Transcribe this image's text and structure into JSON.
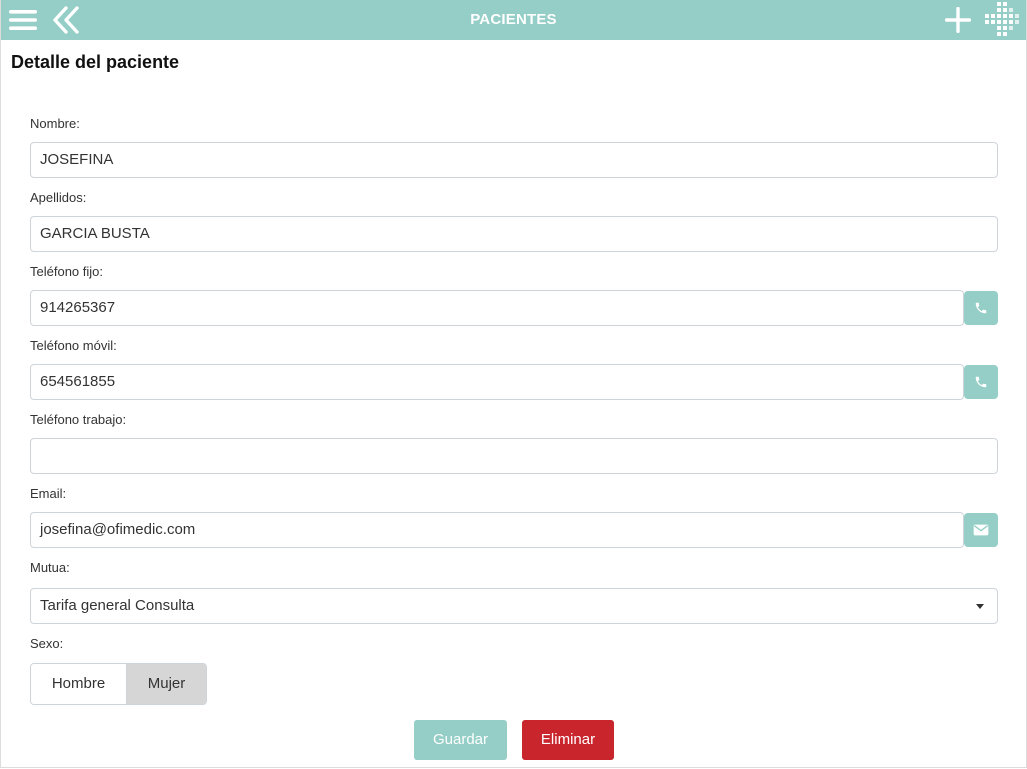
{
  "header": {
    "title": "PACIENTES",
    "menu_icon": "hamburger-menu-icon",
    "back_icon": "double-chevron-left-icon",
    "add_icon": "plus-icon",
    "logo_icon": "pixel-cross-logo-icon"
  },
  "page": {
    "title": "Detalle del paciente"
  },
  "form": {
    "nombre": {
      "label": "Nombre:",
      "value": "JOSEFINA"
    },
    "apellidos": {
      "label": "Apellidos:",
      "value": "GARCIA BUSTA"
    },
    "telefono_fijo": {
      "label": "Teléfono fijo:",
      "value": "914265367",
      "action_icon": "phone-icon"
    },
    "telefono_movil": {
      "label": "Teléfono móvil:",
      "value": "654561855",
      "action_icon": "phone-icon"
    },
    "telefono_trabajo": {
      "label": "Teléfono trabajo:",
      "value": ""
    },
    "email": {
      "label": "Email:",
      "value": "josefina@ofimedic.com",
      "action_icon": "envelope-icon"
    },
    "mutua": {
      "label": "Mutua:",
      "selected": "Tarifa general Consulta"
    },
    "sexo": {
      "label": "Sexo:",
      "options": [
        "Hombre",
        "Mujer"
      ],
      "selected": "Mujer"
    }
  },
  "actions": {
    "save_label": "Guardar",
    "delete_label": "Eliminar"
  },
  "colors": {
    "accent": "#94cec6",
    "danger": "#c9252d",
    "selected_toggle": "#d6d6d6"
  }
}
